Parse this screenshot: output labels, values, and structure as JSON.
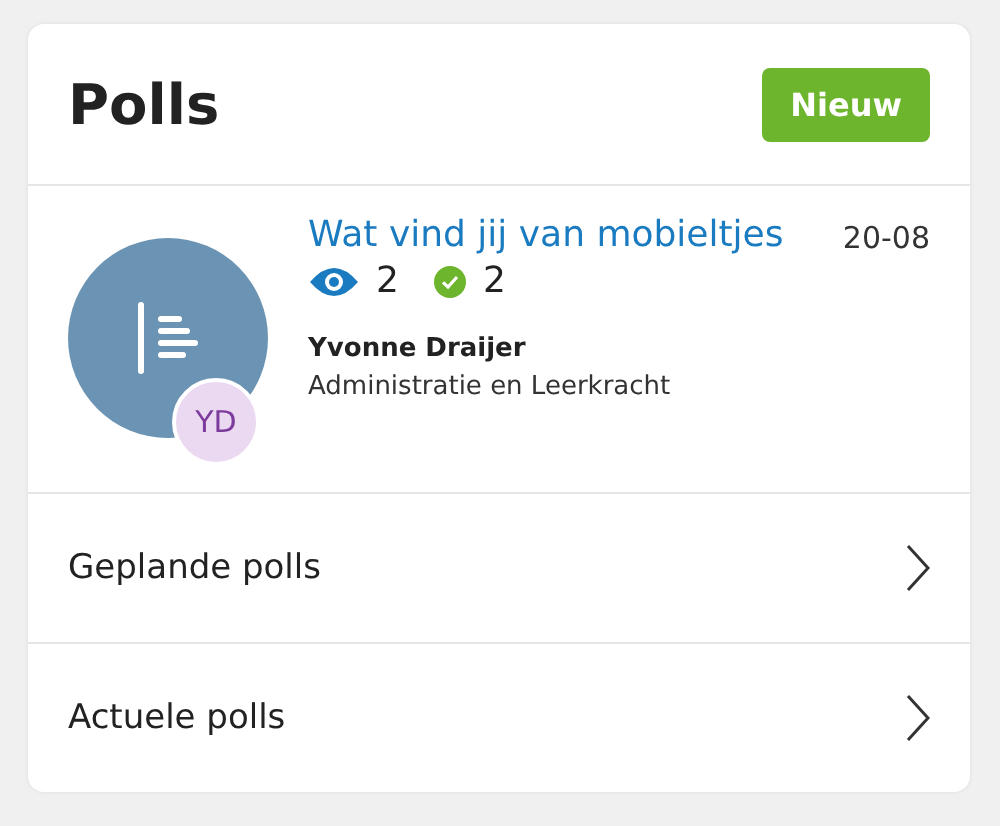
{
  "header": {
    "title": "Polls",
    "button": "Nieuw"
  },
  "poll": {
    "title": "Wat vind jij van mobieltjes",
    "date": "20-08",
    "views": "2",
    "answers": "2",
    "initials": "YD",
    "author": "Yvonne Draijer",
    "role": "Administratie en Leerkracht"
  },
  "links": [
    {
      "label": "Geplande polls"
    },
    {
      "label": "Actuele polls"
    }
  ]
}
